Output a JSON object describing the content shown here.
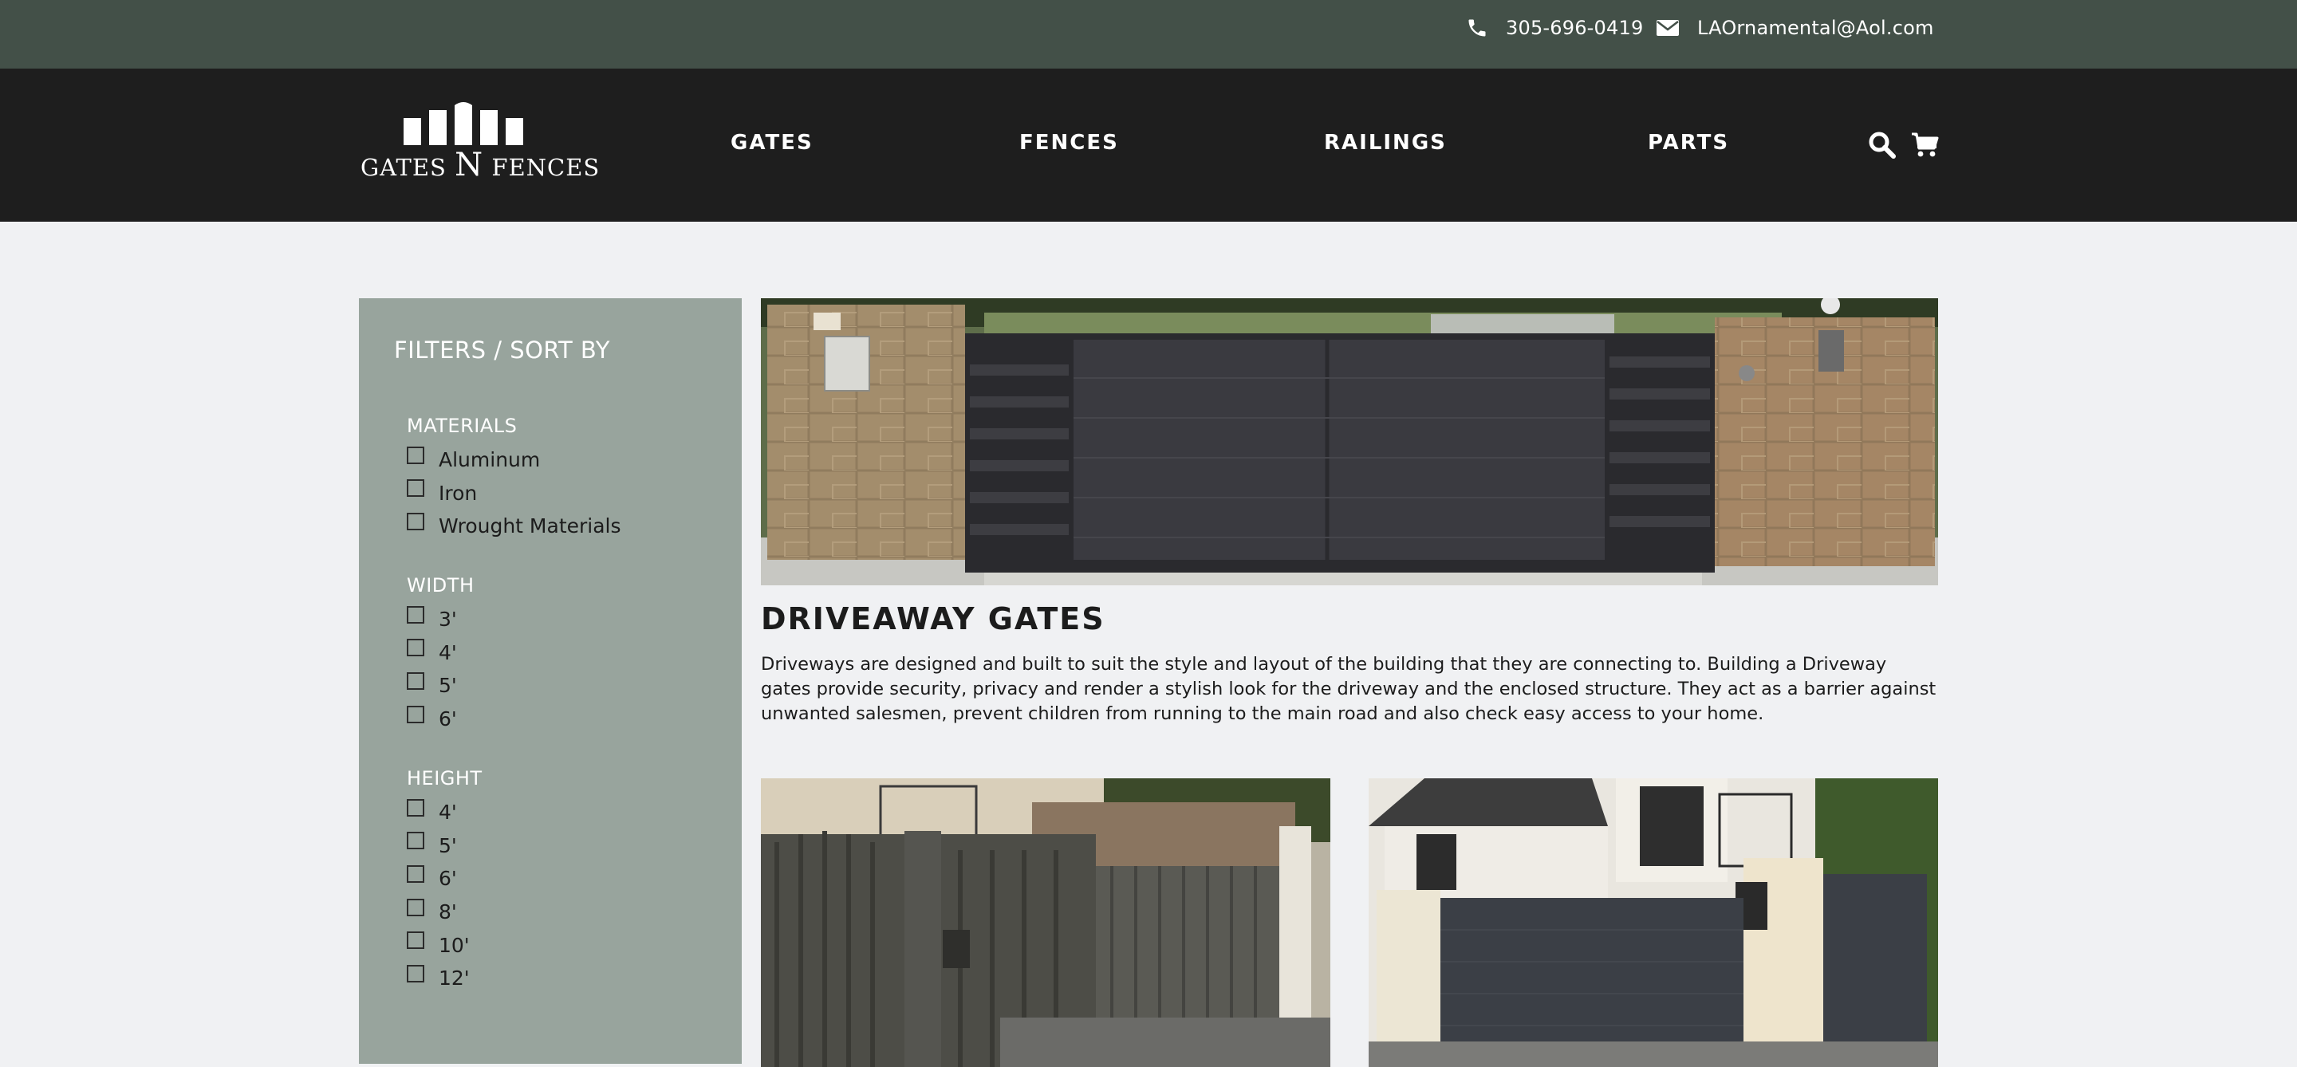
{
  "topbar": {
    "phone_icon": "phone-icon",
    "phone": "305-696-0419",
    "email_icon": "envelope-icon",
    "email": "LAOrnamental@Aol.com",
    "background": "#435048"
  },
  "nav": {
    "logo": {
      "word_1": "Gates",
      "word_2": "N",
      "word_3": "Fences"
    },
    "items": [
      {
        "label": "GATES"
      },
      {
        "label": "FENCES"
      },
      {
        "label": "RAILINGS"
      },
      {
        "label": "PARTS"
      }
    ],
    "search_icon": "search-icon",
    "cart_icon": "cart-icon",
    "background": "#1e1e1e"
  },
  "sidebar": {
    "title": "FILTERS / SORT BY",
    "background": "#98a49d",
    "groups": [
      {
        "title": "MATERIALS",
        "options": [
          "Aluminum",
          "Iron",
          "Wrought Materials"
        ]
      },
      {
        "title": "WIDTH",
        "options": [
          "3'",
          "4'",
          "5'",
          "6'"
        ]
      },
      {
        "title": "HEIGHT",
        "options": [
          "4'",
          "5'",
          "6'",
          "8'",
          "10'",
          "12'"
        ]
      }
    ]
  },
  "main": {
    "heading": "DRIVEAWAY GATES",
    "description": "Driveways are designed and built to suit the style and layout of the building that they are connecting to. Building a Driveway gates provide security, privacy and render a stylish look for the driveway and the enclosed structure. They act as a barrier against unwanted salesmen, prevent children from running to the main road and also check easy access to your home."
  }
}
